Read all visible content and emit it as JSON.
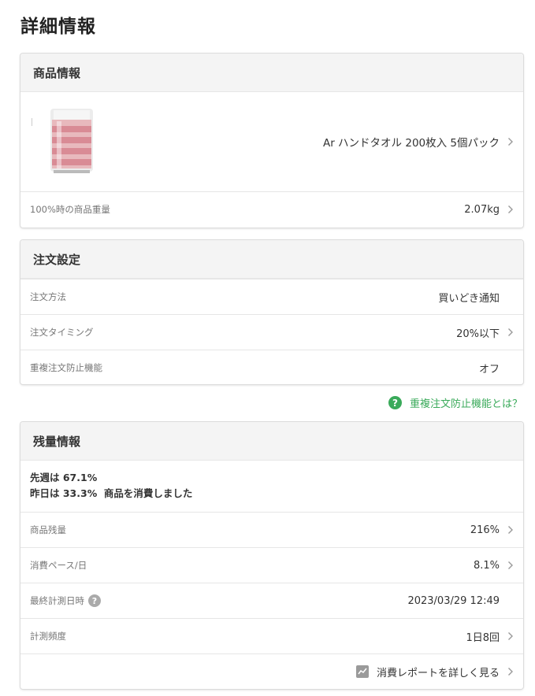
{
  "page_title": "詳細情報",
  "product_section": {
    "header": "商品情報",
    "product_name": "Ar ハンドタオル 200枚入 5個パック",
    "weight_label": "100%時の商品重量",
    "weight_value": "2.07kg"
  },
  "order_section": {
    "header": "注文設定",
    "rows": [
      {
        "label": "注文方法",
        "value": "買いどき通知"
      },
      {
        "label": "注文タイミング",
        "value": "20%以下"
      },
      {
        "label": "重複注文防止機能",
        "value": "オフ"
      }
    ]
  },
  "help_link": {
    "icon": "?",
    "text": "重複注文防止機能とは？"
  },
  "remaining_section": {
    "header": "残量情報",
    "summary_line1": "先週は 67.1%",
    "summary_line2": "昨日は 33.3%  商品を消費しました",
    "rows": [
      {
        "label": "商品残量",
        "value": "216%"
      },
      {
        "label": "消費ペース/日",
        "value": "8.1%"
      },
      {
        "label": "最終計測日時",
        "value": "2023/03/29 12:49"
      },
      {
        "label": "計測頻度",
        "value": "1日8回"
      }
    ],
    "info_icon": "?",
    "report_link": "消費レポートを詳しく見る"
  },
  "colors": {
    "accent_green": "#3aaa5a",
    "header_bg": "#f4f4f4"
  }
}
